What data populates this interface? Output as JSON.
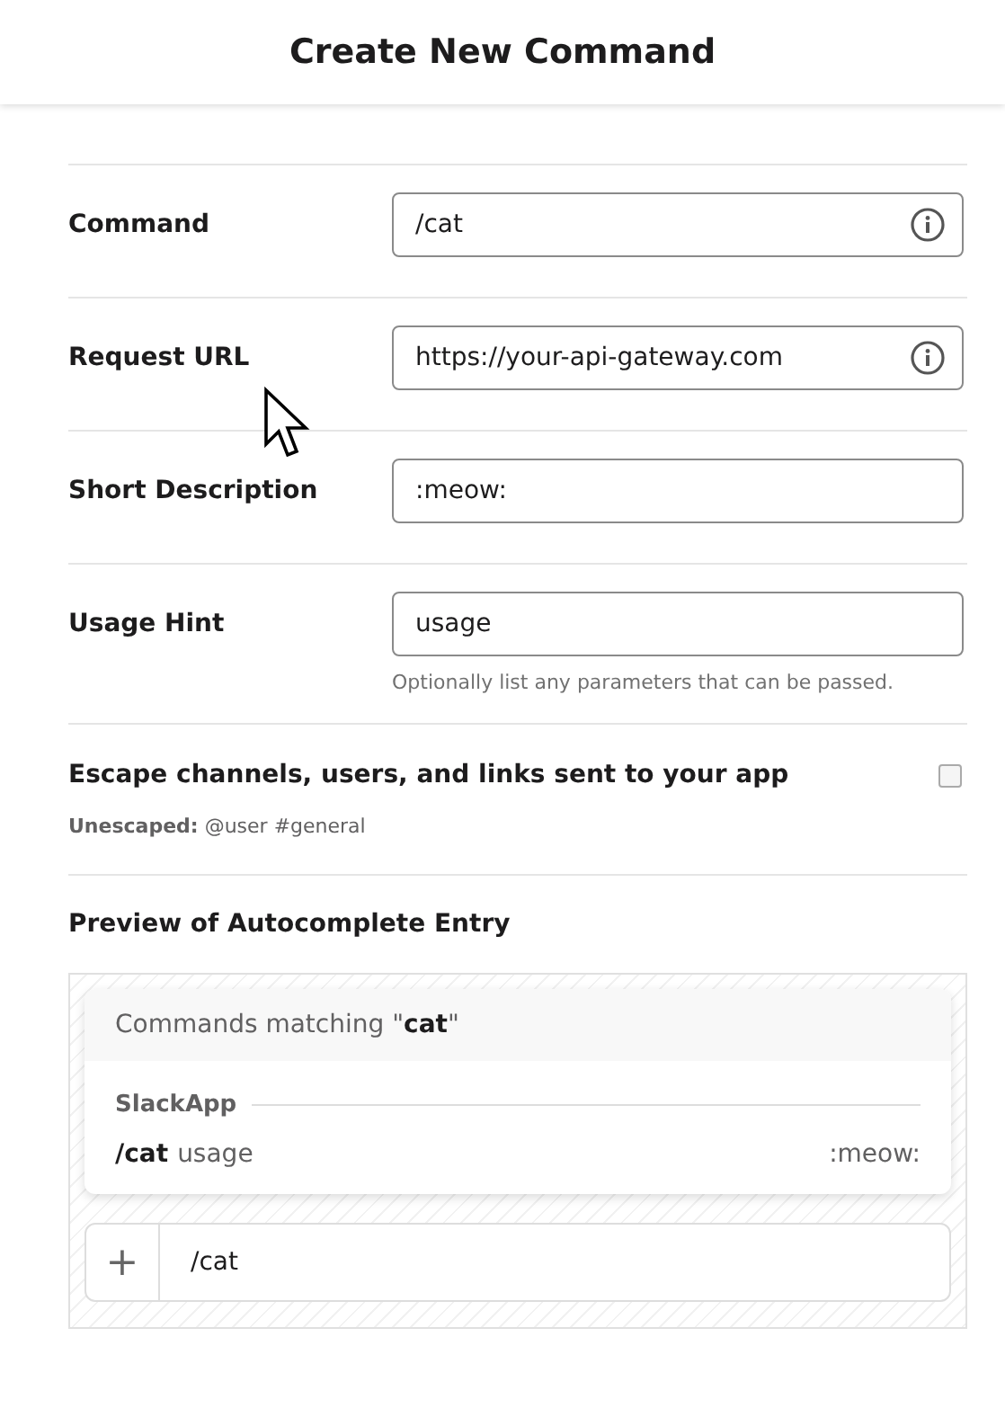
{
  "window": {
    "title": "Create New Command"
  },
  "fields": [
    {
      "label": "Command",
      "value": "/cat",
      "info": true
    },
    {
      "label": "Request URL",
      "value": "https://your-api-gateway.com",
      "info": true
    },
    {
      "label": "Short Description",
      "value": ":meow:",
      "info": false
    },
    {
      "label": "Usage Hint",
      "value": "usage",
      "info": false,
      "hint": "Optionally list any parameters that can be passed."
    }
  ],
  "escape": {
    "label": "Escape channels, users, and links sent to your app",
    "checked": false,
    "note": "**Unescaped:** @user #general"
  },
  "preview": {
    "title": "Preview of Autocomplete Entry",
    "header": "Commands matching \"**cat**\"",
    "app_name": "SlackApp",
    "command": "/cat",
    "usage": "usage",
    "description": ":meow:",
    "plus": "+",
    "message": "/cat"
  }
}
